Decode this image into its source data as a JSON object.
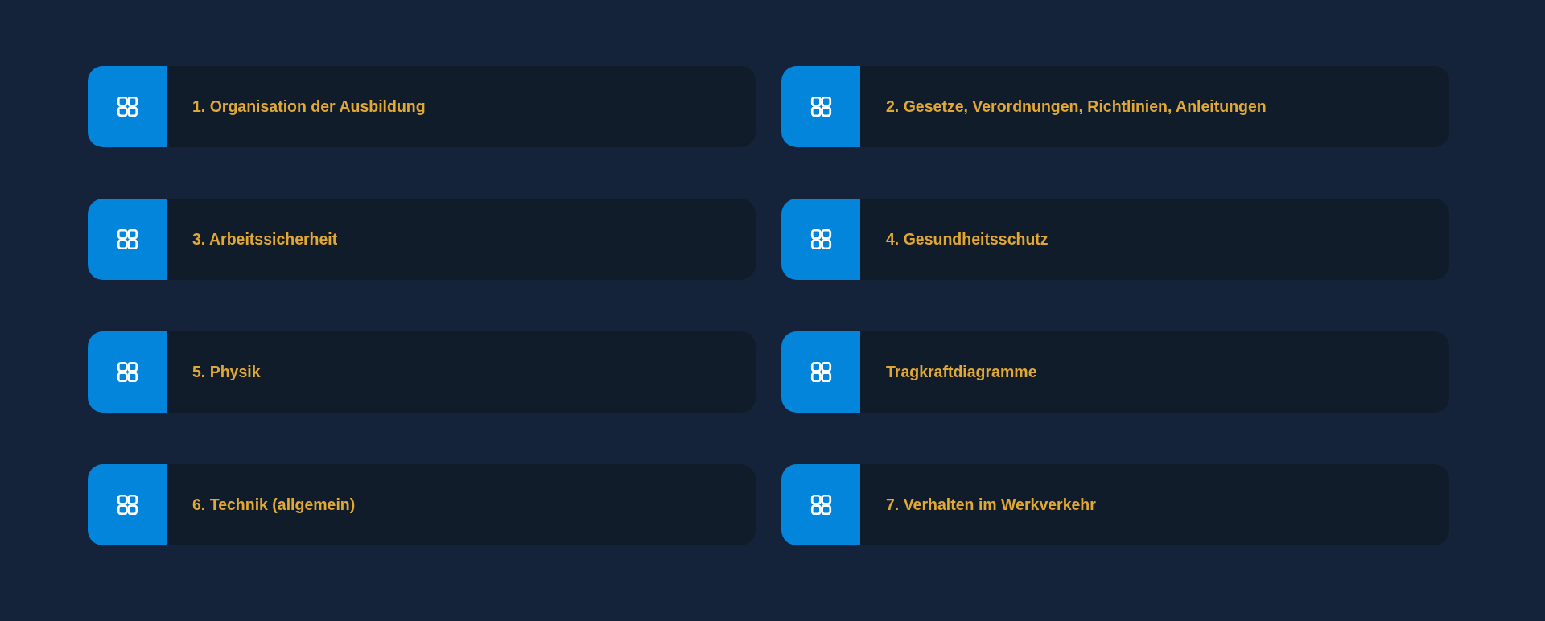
{
  "cards": [
    {
      "label": "1. Organisation der Ausbildung"
    },
    {
      "label": "2. Gesetze, Verordnungen, Richtlinien, Anleitungen"
    },
    {
      "label": "3. Arbeitssicherheit"
    },
    {
      "label": "4. Gesundheitsschutz"
    },
    {
      "label": "5. Physik"
    },
    {
      "label": "Tragkraftdiagramme"
    },
    {
      "label": "6. Technik (allgemein)"
    },
    {
      "label": "7. Verhalten im Werkverkehr"
    }
  ]
}
